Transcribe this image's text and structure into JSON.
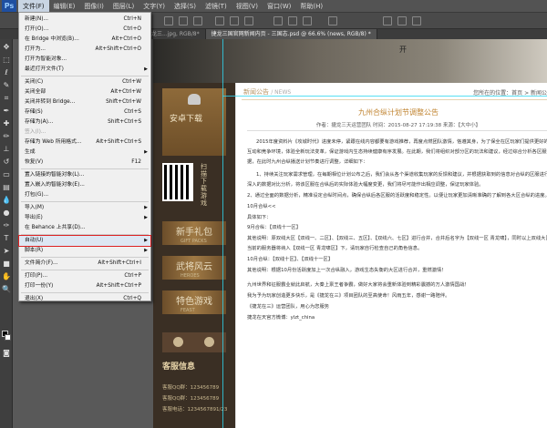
{
  "app": {
    "logo": "Ps"
  },
  "menubar": [
    "文件(F)",
    "编辑(E)",
    "图像(I)",
    "图层(L)",
    "文字(Y)",
    "选择(S)",
    "滤镜(T)",
    "视图(V)",
    "窗口(W)",
    "帮助(H)"
  ],
  "doc_tabs": [
    "龙三...jpg, RGB/8*",
    "捷龙三国官网新闻内页 - 三国志.psd @ 66.6% (news, RGB/8) *"
  ],
  "file_menu": [
    {
      "label": "新建(N)...",
      "shortcut": "Ctrl+N"
    },
    {
      "label": "打开(O)...",
      "shortcut": "Ctrl+O"
    },
    {
      "label": "在 Bridge 中浏览(B)...",
      "shortcut": "Alt+Ctrl+O"
    },
    {
      "label": "打开为...",
      "shortcut": "Alt+Shift+Ctrl+O"
    },
    {
      "label": "打开为智能对象...",
      "shortcut": ""
    },
    {
      "label": "最近打开文件(T)",
      "shortcut": "",
      "submenu": true
    },
    {
      "sep": true
    },
    {
      "label": "关闭(C)",
      "shortcut": "Ctrl+W"
    },
    {
      "label": "关闭全部",
      "shortcut": "Alt+Ctrl+W"
    },
    {
      "label": "关闭并转到 Bridge...",
      "shortcut": "Shift+Ctrl+W"
    },
    {
      "label": "存储(S)",
      "shortcut": "Ctrl+S"
    },
    {
      "label": "存储为(A)...",
      "shortcut": "Shift+Ctrl+S"
    },
    {
      "label": "签入(I)...",
      "shortcut": "",
      "disabled": true
    },
    {
      "label": "存储为 Web 所用格式...",
      "shortcut": "Alt+Shift+Ctrl+S"
    },
    {
      "label": "生成",
      "shortcut": "",
      "submenu": true
    },
    {
      "label": "恢复(V)",
      "shortcut": "F12"
    },
    {
      "sep": true
    },
    {
      "label": "置入链接的智能对象(L)...",
      "shortcut": ""
    },
    {
      "label": "置入嵌入的智能对象(E)...",
      "shortcut": ""
    },
    {
      "label": "打包(G)...",
      "shortcut": ""
    },
    {
      "sep": true
    },
    {
      "label": "导入(M)",
      "shortcut": "",
      "submenu": true
    },
    {
      "label": "导出(E)",
      "shortcut": "",
      "submenu": true
    },
    {
      "label": "在 Behance 上共享(D)...",
      "shortcut": ""
    },
    {
      "sep": true
    },
    {
      "label": "自动(U)",
      "shortcut": "",
      "submenu": true,
      "highlighted": true
    },
    {
      "label": "脚本(R)",
      "shortcut": "",
      "submenu": true
    },
    {
      "sep": true
    },
    {
      "label": "文件简介(F)...",
      "shortcut": "Alt+Shift+Ctrl+I"
    },
    {
      "sep": true
    },
    {
      "label": "打印(P)...",
      "shortcut": "Ctrl+P"
    },
    {
      "label": "打印一份(Y)",
      "shortcut": "Alt+Shift+Ctrl+P"
    },
    {
      "sep": true
    },
    {
      "label": "退出(X)",
      "shortcut": "Ctrl+Q"
    }
  ],
  "hero": {
    "text": "开"
  },
  "sidebar": {
    "download": "安卓下载",
    "qr_label": "扫描下载游戏",
    "buttons": [
      {
        "label": "新手礼包",
        "sub": "GIFT PACKS"
      },
      {
        "label": "武将风云",
        "sub": "HEROES"
      },
      {
        "label": "特色游戏",
        "sub": "FEAST"
      }
    ],
    "service_title": "客服信息",
    "service_lines": [
      "客服QQ群：123456789",
      "客服QQ群：123456789",
      "客服电话：1234567891/23"
    ]
  },
  "content": {
    "section": "新闻公告",
    "section_en": "/ NEWS",
    "breadcrumb": "您所在的位置：首页 > 新闻公告",
    "title": "九州合纵计划节调整公告",
    "meta": "作者：捷龙三天运营团队 时间：2015-08-27 17:19:38 来源：【大中小】",
    "paragraphs": [
      "2015年度资料片《攻城时代》进度未停，紧跟在线内容都要有游戏推荐，再度点燃团队激情，恪遵其身，为了保全在区玩家们提供更好的互动和竞争环境，体验全新玩法变革，保证游戏内生态持续健康有序发展。在此期，我们将组织对部分区的玩法和建议，经过综合分析各区服数据，在此时九州合纵播送计划节奏进行调整，详细如下：",
      "1、持续关注玩家需求管理，在每期相位计划公布之后，我们会从各个渠道收集玩家的反馈和建议，并根据获取到的信息对合纵的区服进行深入的数据对比分析，将该区服在合纵后的实际体验大幅度变更，我们将尽可能作出相应调整，保证玩家体验。",
      "2、通过全面的数据分析，精准设定合纵时间点，确保合纵后各区服的活跃度和稳定性。以便让玩家更加清晰准确的了解到各大区合纵的进度。",
      "10月合纵<<",
      "具体如下：",
      "9月合纵：【双线十一区】",
      "其他说明：原双线大区【双线一、二区】、【双线三、五区】、【双线六、七区】进行合并，合并后名字为【双线一区 青龙啸】，同时以上双线大区当前的服务器将纳入【双线一区 青龙啸区】下，请玩家自行检查自己的角色信息。",
      "10月合纵：【双线十区】、【双线十一区】",
      "其他说明：根据10月份活跃度加上一次合纵融入，游戏生态失衡的大区进行合并，重燃激情！",
      "九州世界和征服霸业就此启航，大秦上禀王者争霸，做好大家将会重新体验到精彩震撼的万人激情国战！",
      "我为予为玩家创造更多快乐，是《捷龙在三》项目团队的至高使命！风雨五年，感谢一路陪伴。",
      "《捷龙在三》运营团队，用心为您服务",
      "捷龙在天官方微博：ylzt_china"
    ]
  },
  "colors": {
    "ps_bg": "#535353",
    "accent": "#c0832f",
    "guide": "#2fd7f0",
    "highlight_box": "#dd2222"
  }
}
